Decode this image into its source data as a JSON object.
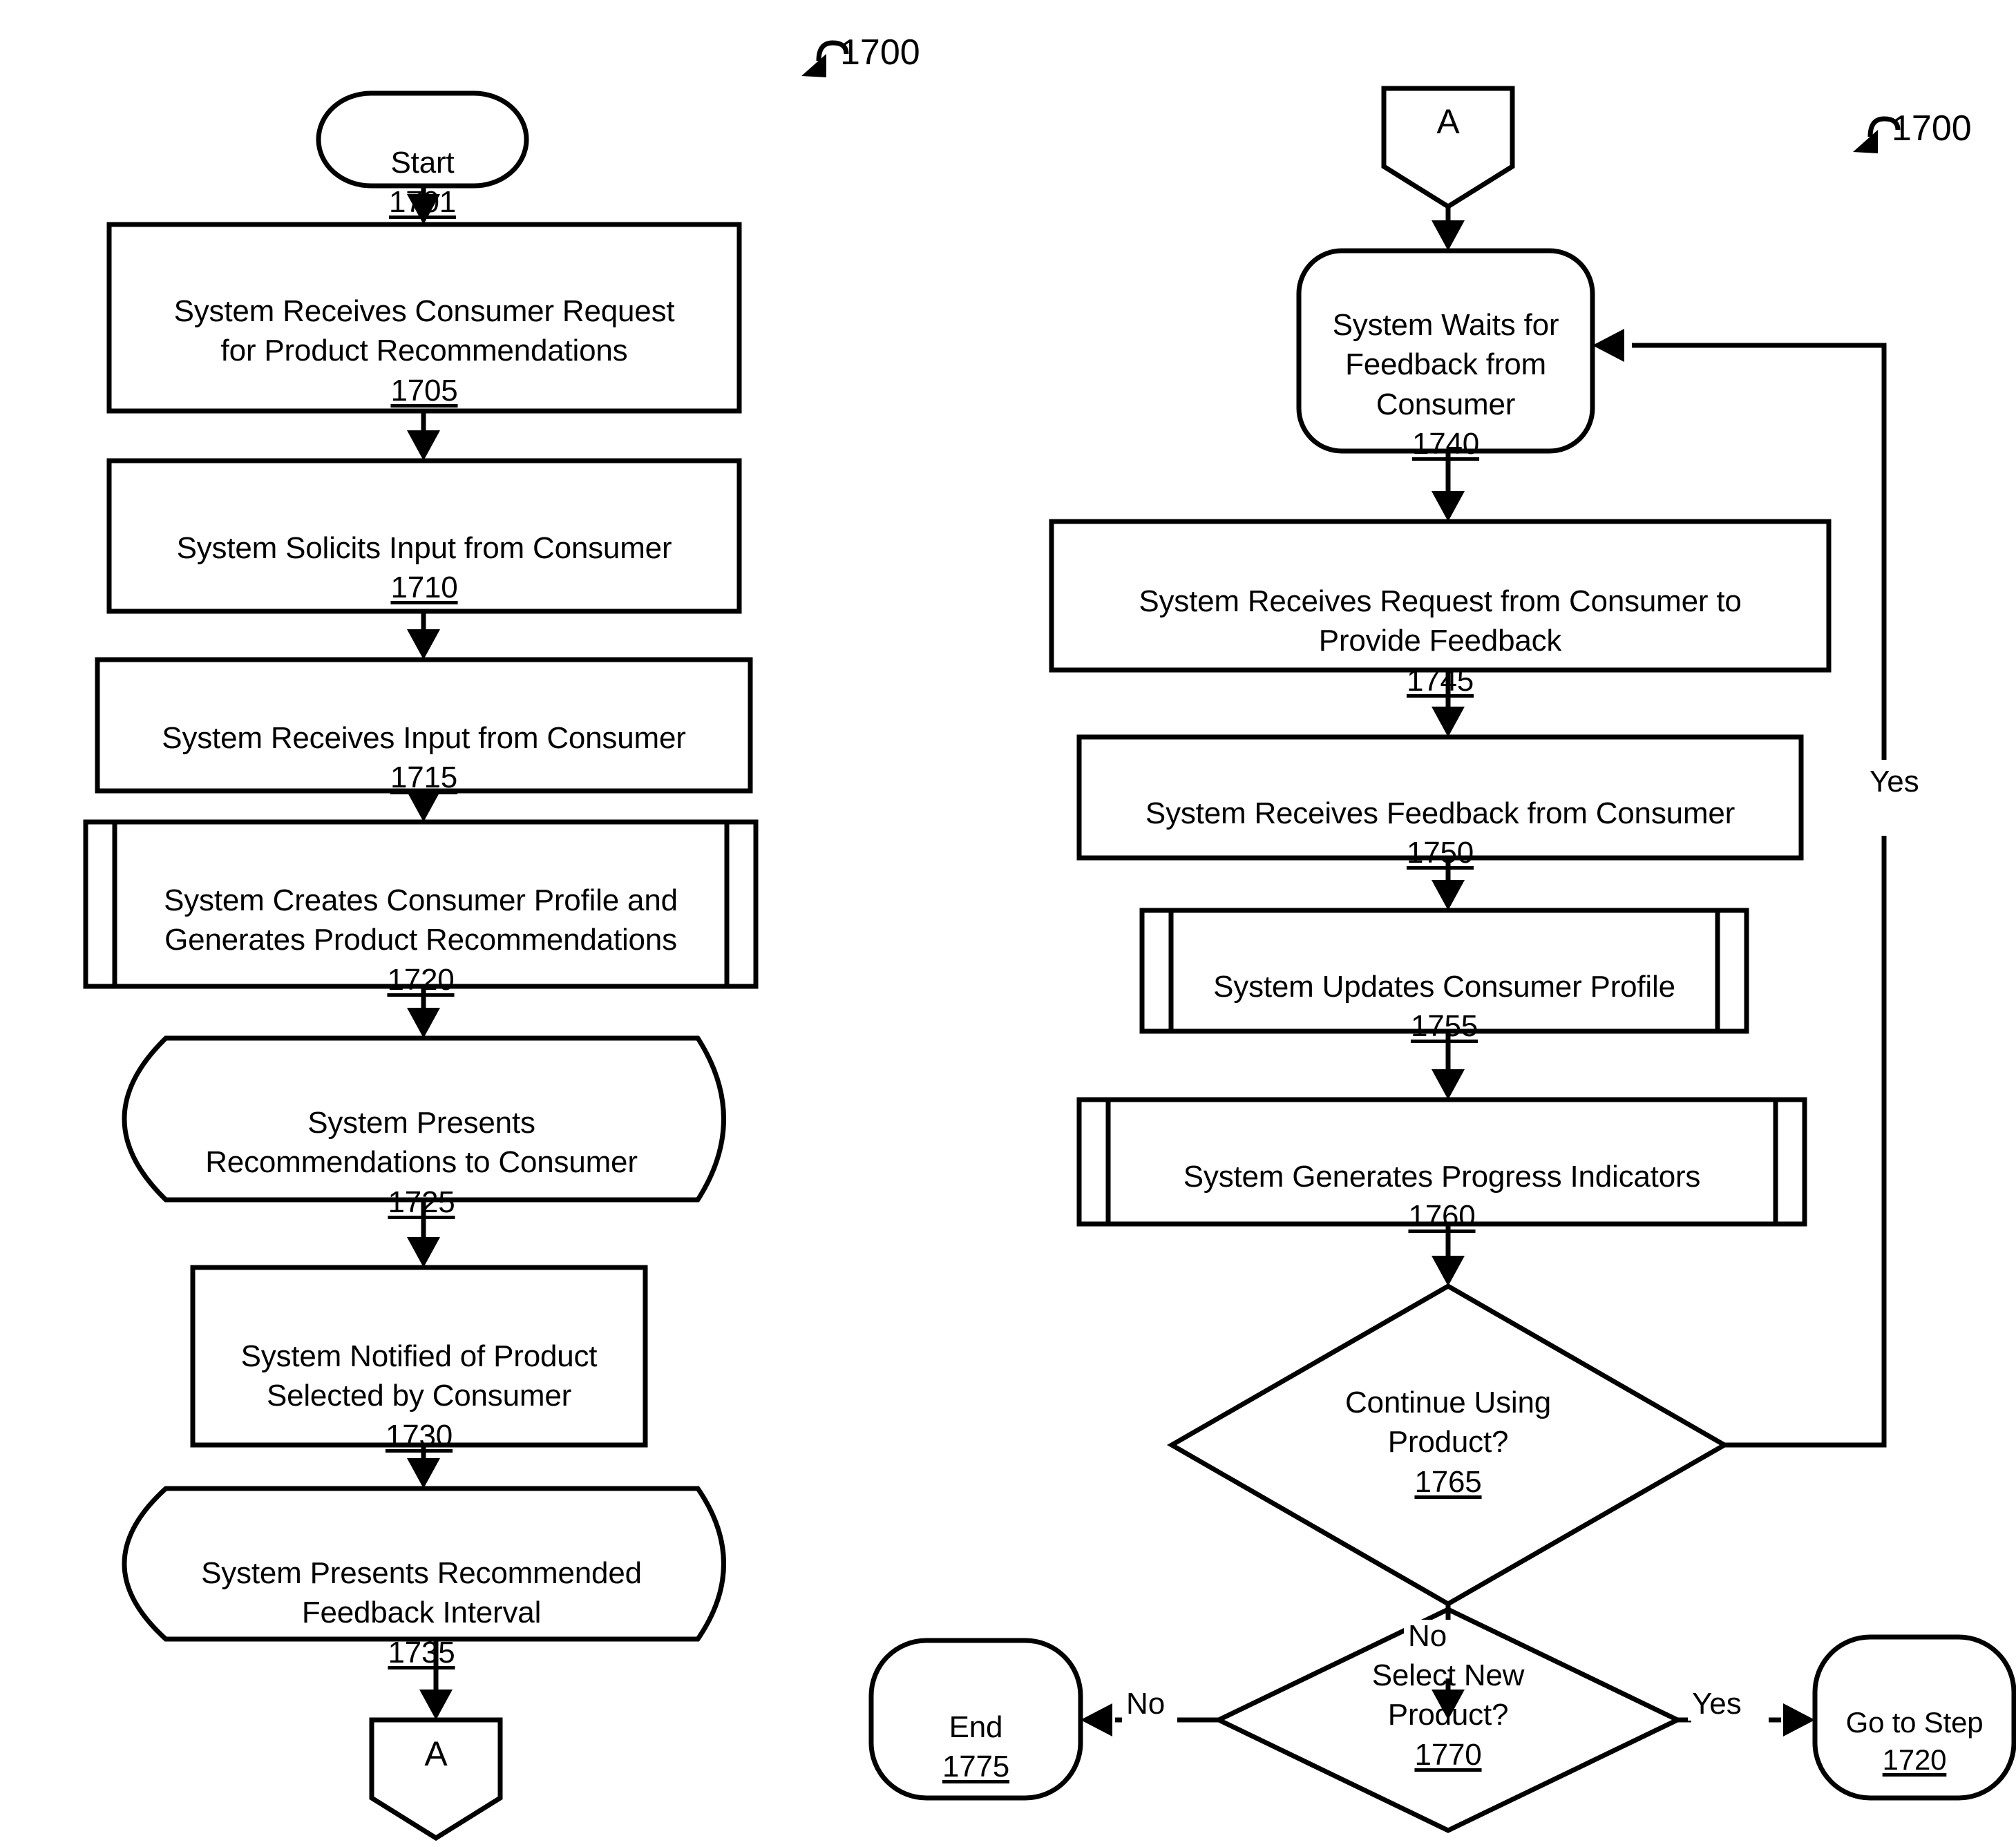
{
  "figure": {
    "reference_numeral_left": "1700",
    "reference_numeral_right": "1700"
  },
  "connectors": {
    "a_bottom_left": "A",
    "a_top_right": "A"
  },
  "left_column": {
    "start": {
      "text": "Start",
      "number": "1701",
      "shape": "stadium"
    },
    "steps": [
      {
        "text": "System Receives Consumer Request\nfor Product Recommendations",
        "number": "1705",
        "shape": "process"
      },
      {
        "text": "System Solicits Input from Consumer",
        "number": "1710",
        "shape": "process"
      },
      {
        "text": "System Receives Input from Consumer",
        "number": "1715",
        "shape": "process"
      },
      {
        "text": "System Creates Consumer Profile and\nGenerates Product Recommendations",
        "number": "1720",
        "shape": "predefined-process"
      },
      {
        "text": "System Presents\nRecommendations to Consumer",
        "number": "1725",
        "shape": "display"
      },
      {
        "text": "System Notified of Product\nSelected by Consumer",
        "number": "1730",
        "shape": "process"
      },
      {
        "text": "System Presents Recommended\nFeedback Interval",
        "number": "1735",
        "shape": "display"
      }
    ]
  },
  "right_column": {
    "steps": [
      {
        "text": "System Waits for\nFeedback from\nConsumer",
        "number": "1740",
        "shape": "rounded-process"
      },
      {
        "text": "System Receives Request from Consumer to\nProvide Feedback",
        "number": "1745",
        "shape": "process"
      },
      {
        "text": "System Receives Feedback from Consumer",
        "number": "1750",
        "shape": "process"
      },
      {
        "text": "System Updates Consumer Profile",
        "number": "1755",
        "shape": "predefined-process"
      },
      {
        "text": "System Generates Progress Indicators",
        "number": "1760",
        "shape": "predefined-process"
      }
    ],
    "decisions": [
      {
        "text": "Continue Using\nProduct?",
        "number": "1765",
        "shape": "diamond"
      },
      {
        "text": "Select New\nProduct?",
        "number": "1770",
        "shape": "diamond"
      }
    ],
    "terminals": [
      {
        "text": "End",
        "number": "1775",
        "shape": "stadium"
      },
      {
        "text": "Go to Step",
        "number": "1720",
        "shape": "stadium"
      }
    ]
  },
  "edge_labels": {
    "continue_yes": "Yes",
    "continue_no": "No",
    "select_no": "No",
    "select_yes": "Yes"
  }
}
